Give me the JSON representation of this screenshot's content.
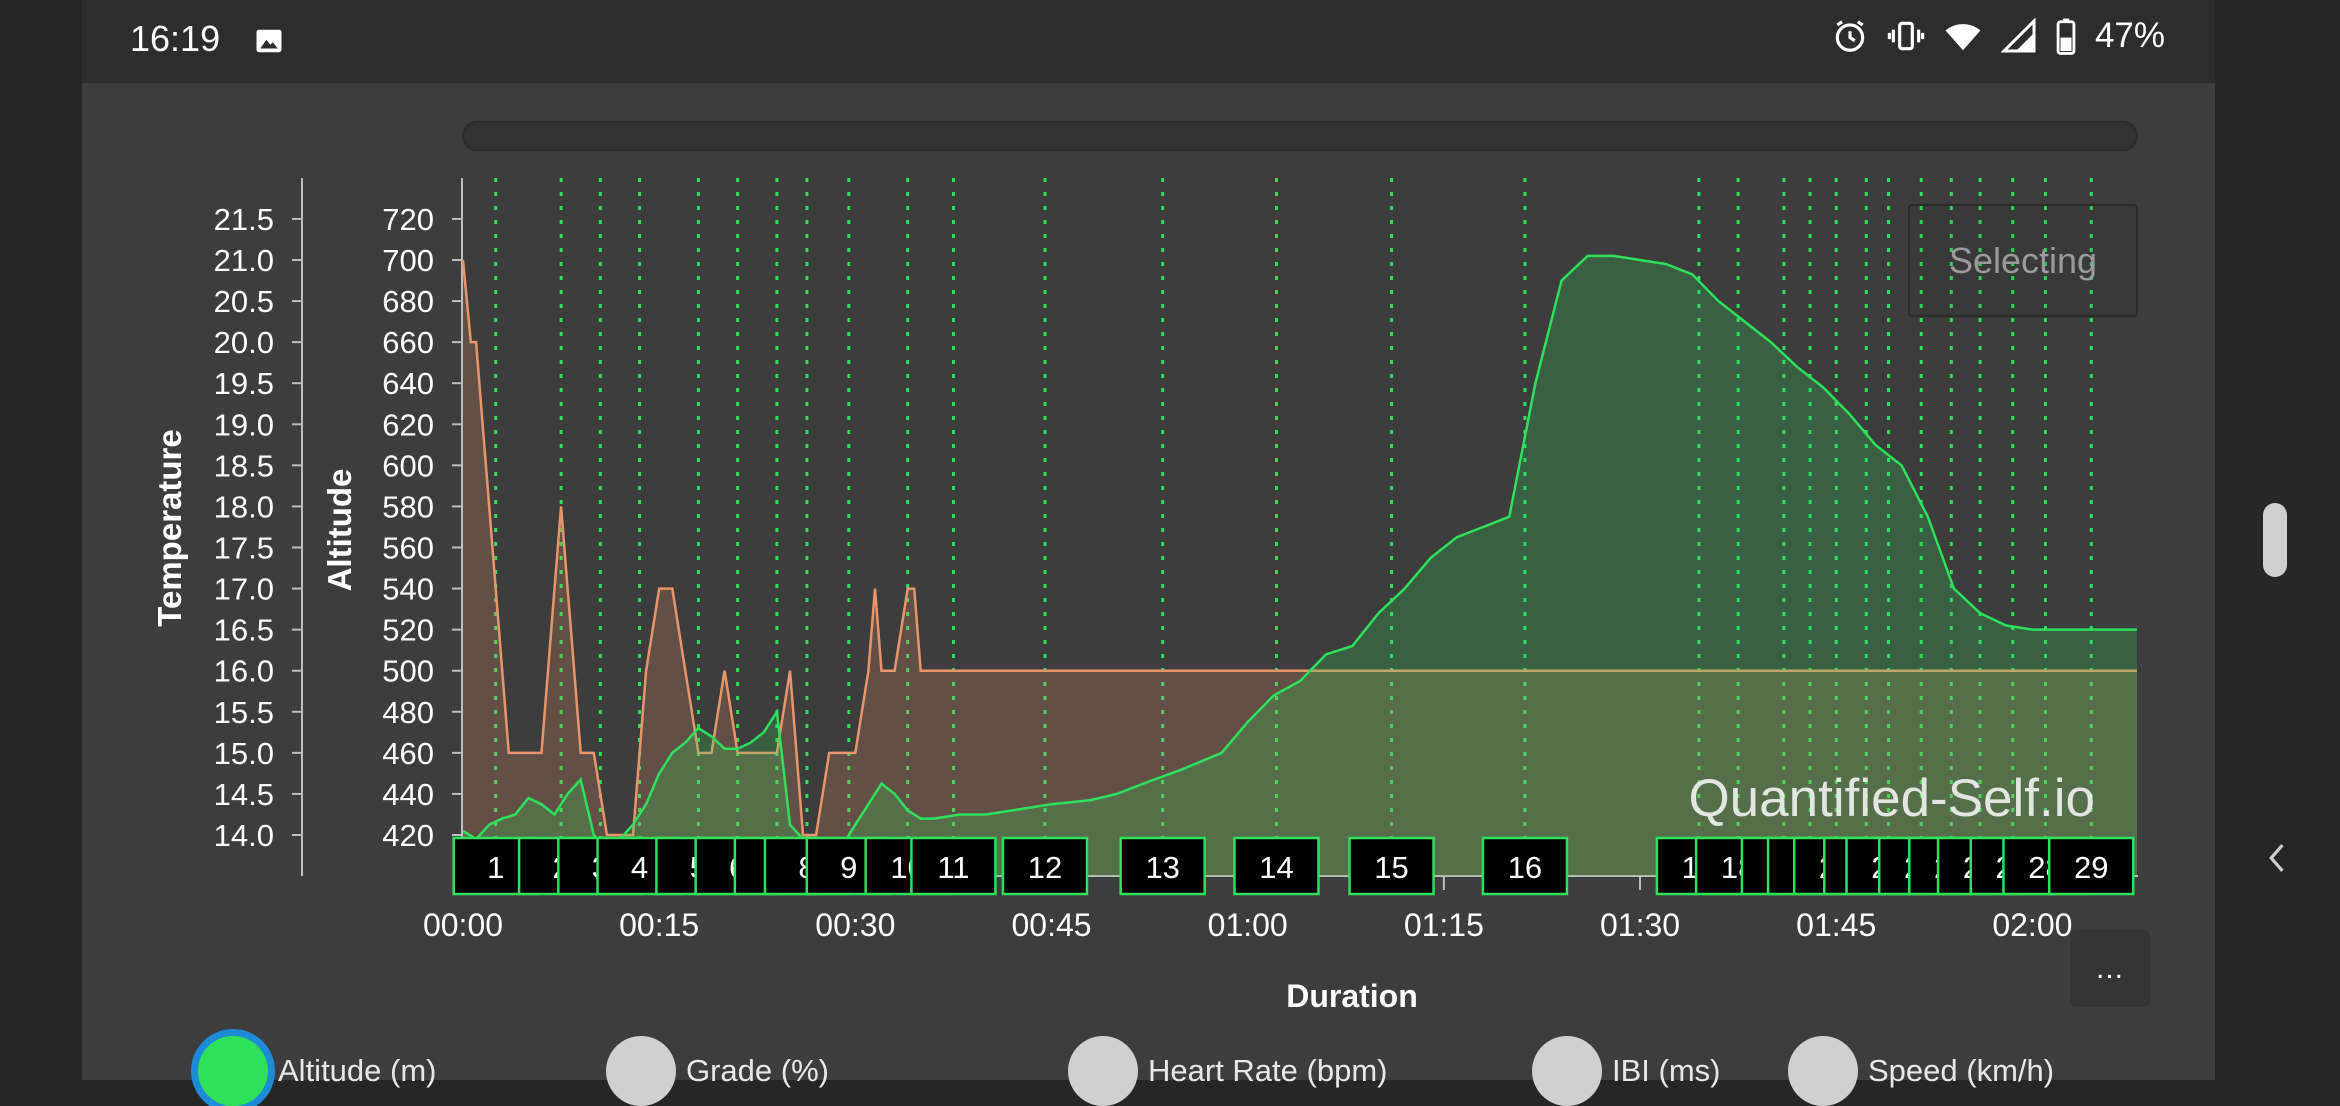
{
  "status_bar": {
    "time": "16:19",
    "battery": "47%",
    "icons": [
      "image-icon",
      "alarm-icon",
      "vibrate-icon",
      "wifi-icon",
      "signal-icon",
      "battery-icon"
    ]
  },
  "chart_controls": {
    "selecting_label": "Selecting",
    "more_label": "..."
  },
  "watermark": "Quantified-Self.io",
  "chart_data": {
    "type": "area",
    "xlabel": "Duration",
    "x_ticks": [
      "00:00",
      "00:15",
      "00:30",
      "00:45",
      "01:00",
      "01:15",
      "01:30",
      "01:45",
      "02:00"
    ],
    "xlim": [
      0,
      128
    ],
    "x_unit": "minutes",
    "y_axes": [
      {
        "label": "Temperature",
        "ticks": [
          "14.0",
          "14.5",
          "15.0",
          "15.5",
          "16.0",
          "16.5",
          "17.0",
          "17.5",
          "18.0",
          "18.5",
          "19.0",
          "19.5",
          "20.0",
          "20.5",
          "21.0",
          "21.5"
        ],
        "ylim": [
          13.5,
          22.0
        ]
      },
      {
        "label": "Altitude",
        "ticks": [
          "420",
          "440",
          "460",
          "480",
          "500",
          "520",
          "540",
          "560",
          "580",
          "600",
          "620",
          "640",
          "660",
          "680",
          "700",
          "720"
        ],
        "ylim": [
          400,
          740
        ]
      }
    ],
    "series": [
      {
        "name": "Altitude (m)",
        "axis": "Altitude",
        "color": "#2ee05a",
        "x": [
          0,
          1,
          2,
          3,
          4,
          5,
          6,
          7,
          8,
          9,
          10,
          11,
          12,
          13,
          14,
          15,
          16,
          17,
          18,
          19,
          20,
          21,
          22,
          23,
          24,
          25,
          26,
          27,
          28,
          29,
          30,
          31,
          32,
          33,
          34,
          35,
          36,
          38,
          40,
          42,
          45,
          48,
          50,
          52,
          55,
          58,
          60,
          62,
          64,
          66,
          68,
          70,
          72,
          74,
          76,
          78,
          80,
          82,
          84,
          86,
          88,
          90,
          92,
          94,
          96,
          98,
          100,
          102,
          104,
          106,
          108,
          110,
          112,
          114,
          116,
          118,
          120,
          122,
          124,
          126,
          128
        ],
        "values": [
          422,
          418,
          425,
          428,
          430,
          438,
          435,
          430,
          440,
          447,
          420,
          413,
          418,
          425,
          435,
          450,
          460,
          465,
          472,
          468,
          462,
          462,
          465,
          470,
          480,
          425,
          418,
          412,
          410,
          415,
          425,
          435,
          445,
          440,
          432,
          428,
          428,
          430,
          430,
          432,
          435,
          437,
          440,
          445,
          452,
          460,
          475,
          488,
          495,
          508,
          512,
          528,
          540,
          555,
          565,
          570,
          575,
          640,
          690,
          702,
          702,
          700,
          698,
          693,
          680,
          670,
          660,
          648,
          638,
          625,
          610,
          600,
          575,
          540,
          528,
          522,
          520,
          520,
          520,
          520,
          520
        ]
      },
      {
        "name": "Temperature",
        "axis": "Temperature",
        "color": "#e8956a",
        "x": [
          0,
          0.6,
          1,
          1.5,
          2,
          2.5,
          3,
          3.5,
          4,
          6,
          6.5,
          7,
          7.5,
          8,
          8.5,
          9,
          10,
          11,
          12,
          13,
          13.5,
          14,
          15,
          16,
          17,
          18,
          19,
          20,
          21,
          22,
          23,
          24,
          25,
          25.5,
          26,
          27,
          28,
          30,
          31,
          31.5,
          32,
          33,
          34,
          34.5,
          35,
          36,
          37,
          128
        ],
        "values": [
          21.0,
          20.0,
          20.0,
          19.0,
          18.0,
          17.0,
          16.0,
          15.0,
          15.0,
          15.0,
          16.0,
          17.0,
          18.0,
          17.0,
          16.0,
          15.0,
          15.0,
          14.0,
          14.0,
          14.0,
          15.0,
          16.0,
          17.0,
          17.0,
          16.0,
          15.0,
          15.0,
          16.0,
          15.0,
          15.0,
          15.0,
          15.0,
          16.0,
          15.0,
          14.0,
          14.0,
          15.0,
          15.0,
          16.0,
          17.0,
          16.0,
          16.0,
          17.0,
          17.0,
          16.0,
          16.0,
          16.0,
          16.0
        ]
      }
    ],
    "lap_markers": {
      "x": [
        2.5,
        7.5,
        10.5,
        13.5,
        18,
        21,
        24,
        26.3,
        29.5,
        34,
        37.5,
        44.5,
        53.5,
        62.2,
        71,
        81.2,
        94.5,
        97.5,
        101,
        103,
        105,
        107.3,
        109,
        111.5,
        113.8,
        116,
        118.5,
        121,
        124.5
      ],
      "labels": [
        "1",
        "2",
        "3",
        "4",
        "5",
        "6",
        "7",
        "8",
        "9",
        "10",
        "11",
        "12",
        "13",
        "14",
        "15",
        "16",
        "17",
        "18",
        "19",
        "20",
        "21",
        "22",
        "23",
        "24",
        "25",
        "26",
        "27",
        "28",
        "29"
      ],
      "shown": [
        "1",
        "2",
        "3",
        "4",
        "5",
        "6",
        "",
        "8",
        "9",
        "10",
        "11",
        "12",
        "13",
        "14",
        "15",
        "16",
        "1",
        "18",
        "2",
        "2",
        "2",
        "1",
        "2",
        "2",
        "",
        "2",
        "2",
        "2",
        "29"
      ]
    },
    "grid": false
  },
  "legend": [
    {
      "label": "Altitude (m)",
      "active": true
    },
    {
      "label": "Grade (%)",
      "active": false
    },
    {
      "label": "Heart Rate (bpm)",
      "active": false
    },
    {
      "label": "IBI (ms)",
      "active": false
    },
    {
      "label": "Speed (km/h)",
      "active": false
    }
  ]
}
